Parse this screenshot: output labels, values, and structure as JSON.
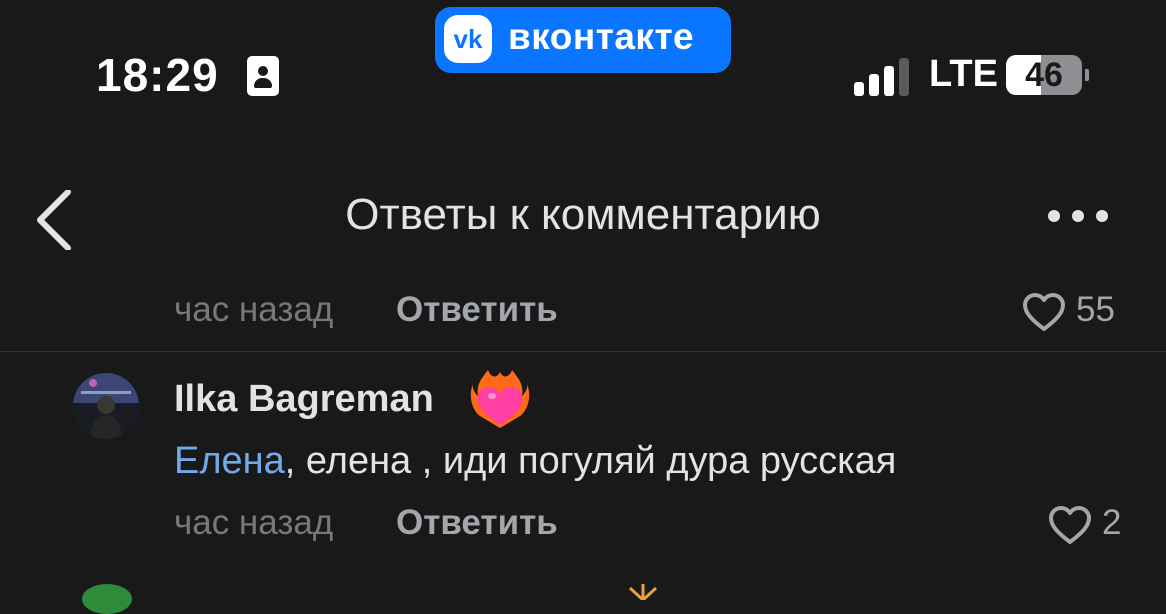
{
  "status_bar": {
    "time": "18:29",
    "app_pill": {
      "label": "вконтакте",
      "logo_text": "vk",
      "color": "#0a76ff"
    },
    "network": "LTE",
    "battery_level": "46",
    "battery_percent": 46,
    "signal_bars_active": 3,
    "signal_bars_total": 4
  },
  "header": {
    "title": "Ответы к комментарию",
    "back_icon": "chevron-left-icon",
    "more_icon": "more-horizontal-icon"
  },
  "comments": [
    {
      "time": "час назад",
      "reply_label": "Ответить",
      "likes": "55"
    },
    {
      "author": "Ilka Bagreman",
      "badge_icon": "flaming-heart-icon",
      "mention": "Елена",
      "text": ", елена , иди погуляй дура русская",
      "time": "час назад",
      "reply_label": "Ответить",
      "likes": "2"
    }
  ],
  "colors": {
    "background": "#19191a",
    "text": "#e1e3e6",
    "secondary": "#76787a",
    "mention": "#71aaeb",
    "accent": "#0a76ff"
  }
}
